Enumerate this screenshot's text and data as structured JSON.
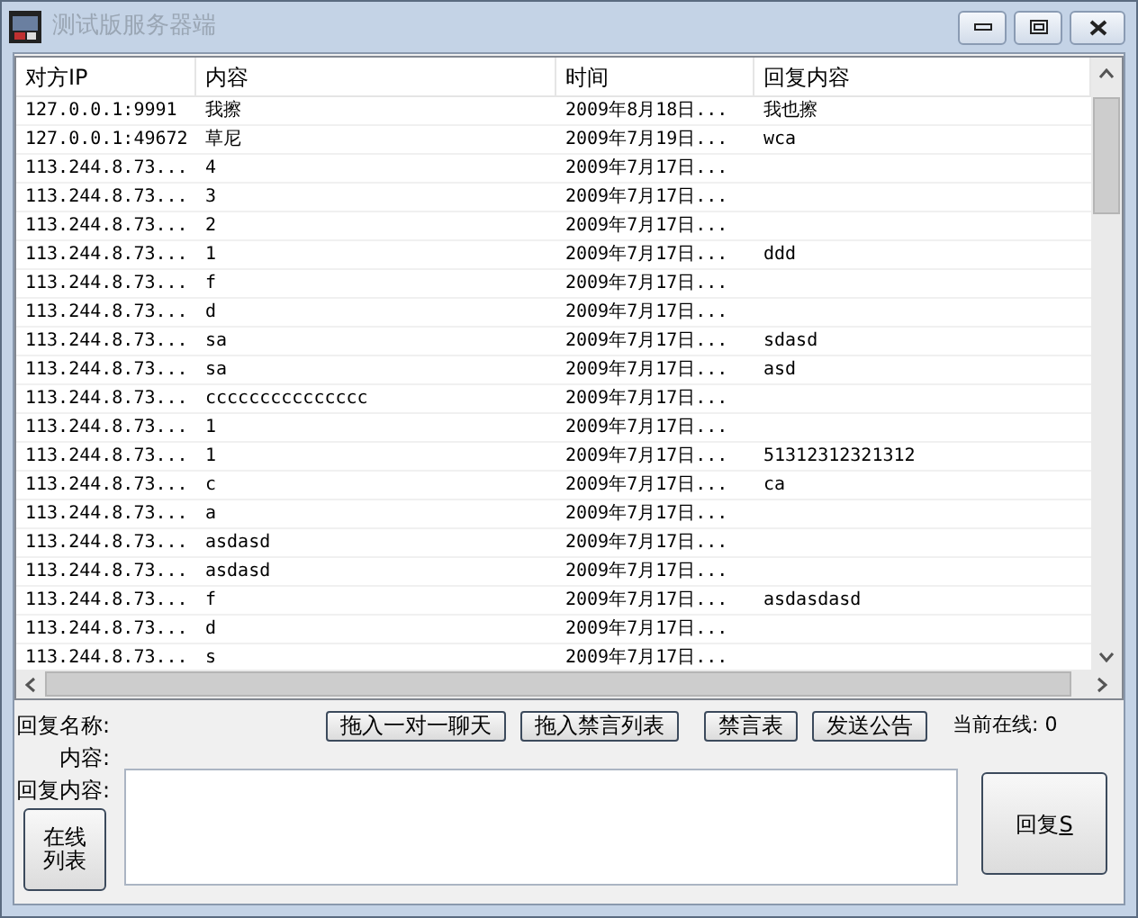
{
  "window": {
    "title": "测试版服务器端"
  },
  "table": {
    "columns": [
      "对方IP",
      "内容",
      "时间",
      "回复内容"
    ],
    "rows": [
      [
        "127.0.0.1:9991",
        "我擦",
        "2009年8月18日...",
        "我也擦"
      ],
      [
        "127.0.0.1:49672",
        "草尼",
        "2009年7月19日...",
        "wca"
      ],
      [
        "113.244.8.73...",
        "4",
        "2009年7月17日...",
        ""
      ],
      [
        "113.244.8.73...",
        "3",
        "2009年7月17日...",
        ""
      ],
      [
        "113.244.8.73...",
        "2",
        "2009年7月17日...",
        ""
      ],
      [
        "113.244.8.73...",
        "1",
        "2009年7月17日...",
        "ddd"
      ],
      [
        "113.244.8.73...",
        "f",
        "2009年7月17日...",
        ""
      ],
      [
        "113.244.8.73...",
        "d",
        "2009年7月17日...",
        ""
      ],
      [
        "113.244.8.73...",
        "sa",
        "2009年7月17日...",
        "sdasd"
      ],
      [
        "113.244.8.73...",
        "sa",
        "2009年7月17日...",
        "asd"
      ],
      [
        "113.244.8.73...",
        "ccccccccccccccc",
        "2009年7月17日...",
        ""
      ],
      [
        "113.244.8.73...",
        "1",
        "2009年7月17日...",
        ""
      ],
      [
        "113.244.8.73...",
        "1",
        "2009年7月17日...",
        "51312312321312"
      ],
      [
        "113.244.8.73...",
        "c",
        "2009年7月17日...",
        "ca"
      ],
      [
        "113.244.8.73...",
        "a",
        "2009年7月17日...",
        ""
      ],
      [
        "113.244.8.73...",
        "asdasd",
        "2009年7月17日...",
        ""
      ],
      [
        "113.244.8.73...",
        "asdasd",
        "2009年7月17日...",
        ""
      ],
      [
        "113.244.8.73...",
        "f",
        "2009年7月17日...",
        "asdasdasd"
      ],
      [
        "113.244.8.73...",
        "d",
        "2009年7月17日...",
        ""
      ],
      [
        "113.244.8.73...",
        "s",
        "2009年7月17日...",
        ""
      ]
    ]
  },
  "reply_name_label": "回复名称:",
  "content_label": "内容:",
  "reply_content_label": "回复内容:",
  "action_buttons": [
    "拖入一对一聊天",
    "拖入禁言列表",
    "禁言表",
    "发送公告"
  ],
  "online_count": "当前在线: 0",
  "online_list_button": {
    "line1": "在线",
    "line2": "列表"
  },
  "reply_button": {
    "label": "回复",
    "accesskey": "S"
  }
}
